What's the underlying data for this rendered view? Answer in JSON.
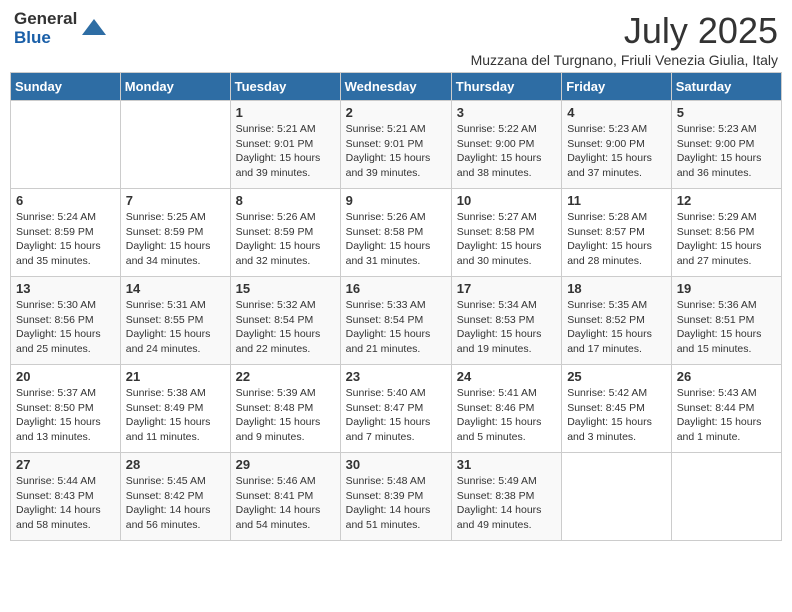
{
  "header": {
    "logo_line1": "General",
    "logo_line2": "Blue",
    "month_title": "July 2025",
    "location": "Muzzana del Turgnano, Friuli Venezia Giulia, Italy"
  },
  "days_of_week": [
    "Sunday",
    "Monday",
    "Tuesday",
    "Wednesday",
    "Thursday",
    "Friday",
    "Saturday"
  ],
  "weeks": [
    [
      {
        "num": "",
        "info": ""
      },
      {
        "num": "",
        "info": ""
      },
      {
        "num": "1",
        "info": "Sunrise: 5:21 AM\nSunset: 9:01 PM\nDaylight: 15 hours and 39 minutes."
      },
      {
        "num": "2",
        "info": "Sunrise: 5:21 AM\nSunset: 9:01 PM\nDaylight: 15 hours and 39 minutes."
      },
      {
        "num": "3",
        "info": "Sunrise: 5:22 AM\nSunset: 9:00 PM\nDaylight: 15 hours and 38 minutes."
      },
      {
        "num": "4",
        "info": "Sunrise: 5:23 AM\nSunset: 9:00 PM\nDaylight: 15 hours and 37 minutes."
      },
      {
        "num": "5",
        "info": "Sunrise: 5:23 AM\nSunset: 9:00 PM\nDaylight: 15 hours and 36 minutes."
      }
    ],
    [
      {
        "num": "6",
        "info": "Sunrise: 5:24 AM\nSunset: 8:59 PM\nDaylight: 15 hours and 35 minutes."
      },
      {
        "num": "7",
        "info": "Sunrise: 5:25 AM\nSunset: 8:59 PM\nDaylight: 15 hours and 34 minutes."
      },
      {
        "num": "8",
        "info": "Sunrise: 5:26 AM\nSunset: 8:59 PM\nDaylight: 15 hours and 32 minutes."
      },
      {
        "num": "9",
        "info": "Sunrise: 5:26 AM\nSunset: 8:58 PM\nDaylight: 15 hours and 31 minutes."
      },
      {
        "num": "10",
        "info": "Sunrise: 5:27 AM\nSunset: 8:58 PM\nDaylight: 15 hours and 30 minutes."
      },
      {
        "num": "11",
        "info": "Sunrise: 5:28 AM\nSunset: 8:57 PM\nDaylight: 15 hours and 28 minutes."
      },
      {
        "num": "12",
        "info": "Sunrise: 5:29 AM\nSunset: 8:56 PM\nDaylight: 15 hours and 27 minutes."
      }
    ],
    [
      {
        "num": "13",
        "info": "Sunrise: 5:30 AM\nSunset: 8:56 PM\nDaylight: 15 hours and 25 minutes."
      },
      {
        "num": "14",
        "info": "Sunrise: 5:31 AM\nSunset: 8:55 PM\nDaylight: 15 hours and 24 minutes."
      },
      {
        "num": "15",
        "info": "Sunrise: 5:32 AM\nSunset: 8:54 PM\nDaylight: 15 hours and 22 minutes."
      },
      {
        "num": "16",
        "info": "Sunrise: 5:33 AM\nSunset: 8:54 PM\nDaylight: 15 hours and 21 minutes."
      },
      {
        "num": "17",
        "info": "Sunrise: 5:34 AM\nSunset: 8:53 PM\nDaylight: 15 hours and 19 minutes."
      },
      {
        "num": "18",
        "info": "Sunrise: 5:35 AM\nSunset: 8:52 PM\nDaylight: 15 hours and 17 minutes."
      },
      {
        "num": "19",
        "info": "Sunrise: 5:36 AM\nSunset: 8:51 PM\nDaylight: 15 hours and 15 minutes."
      }
    ],
    [
      {
        "num": "20",
        "info": "Sunrise: 5:37 AM\nSunset: 8:50 PM\nDaylight: 15 hours and 13 minutes."
      },
      {
        "num": "21",
        "info": "Sunrise: 5:38 AM\nSunset: 8:49 PM\nDaylight: 15 hours and 11 minutes."
      },
      {
        "num": "22",
        "info": "Sunrise: 5:39 AM\nSunset: 8:48 PM\nDaylight: 15 hours and 9 minutes."
      },
      {
        "num": "23",
        "info": "Sunrise: 5:40 AM\nSunset: 8:47 PM\nDaylight: 15 hours and 7 minutes."
      },
      {
        "num": "24",
        "info": "Sunrise: 5:41 AM\nSunset: 8:46 PM\nDaylight: 15 hours and 5 minutes."
      },
      {
        "num": "25",
        "info": "Sunrise: 5:42 AM\nSunset: 8:45 PM\nDaylight: 15 hours and 3 minutes."
      },
      {
        "num": "26",
        "info": "Sunrise: 5:43 AM\nSunset: 8:44 PM\nDaylight: 15 hours and 1 minute."
      }
    ],
    [
      {
        "num": "27",
        "info": "Sunrise: 5:44 AM\nSunset: 8:43 PM\nDaylight: 14 hours and 58 minutes."
      },
      {
        "num": "28",
        "info": "Sunrise: 5:45 AM\nSunset: 8:42 PM\nDaylight: 14 hours and 56 minutes."
      },
      {
        "num": "29",
        "info": "Sunrise: 5:46 AM\nSunset: 8:41 PM\nDaylight: 14 hours and 54 minutes."
      },
      {
        "num": "30",
        "info": "Sunrise: 5:48 AM\nSunset: 8:39 PM\nDaylight: 14 hours and 51 minutes."
      },
      {
        "num": "31",
        "info": "Sunrise: 5:49 AM\nSunset: 8:38 PM\nDaylight: 14 hours and 49 minutes."
      },
      {
        "num": "",
        "info": ""
      },
      {
        "num": "",
        "info": ""
      }
    ]
  ]
}
